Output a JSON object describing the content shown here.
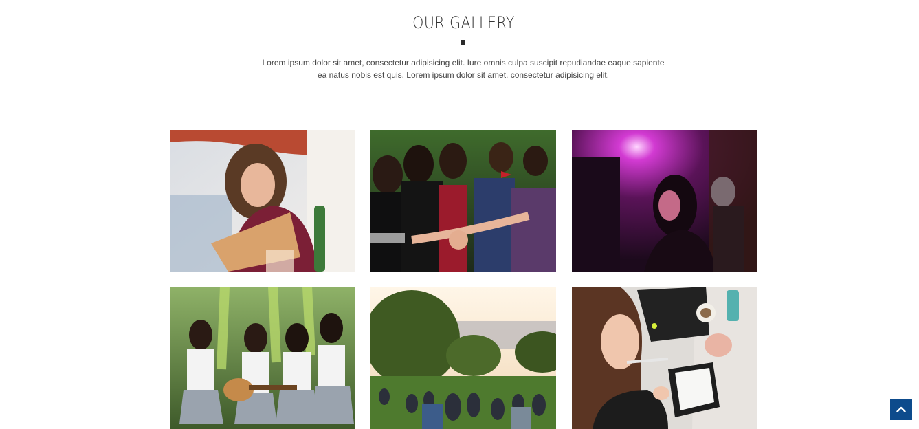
{
  "gallery": {
    "title": "OUR GALLERY",
    "intro_line1": "Lorem ipsum dolor sit amet, consectetur adipisicing elit. Iure omnis culpa suscipit repudiandae eaque sapiente",
    "intro_line2": "ea natus nobis est quis. Lorem ipsum dolor sit amet, consectetur adipisicing elit.",
    "accent_color": "#1f4b86",
    "images": [
      {
        "subject": "woman reading menu outdoors"
      },
      {
        "subject": "group of teens holding hands"
      },
      {
        "subject": "woman in purple club light"
      },
      {
        "subject": "schoolgirls with guitar"
      },
      {
        "subject": "crowd sitting in park at sunset"
      },
      {
        "subject": "woman writing at desk"
      }
    ]
  },
  "back_to_top": {
    "icon": "chevron-up-icon",
    "color": "#0d4b8c"
  }
}
